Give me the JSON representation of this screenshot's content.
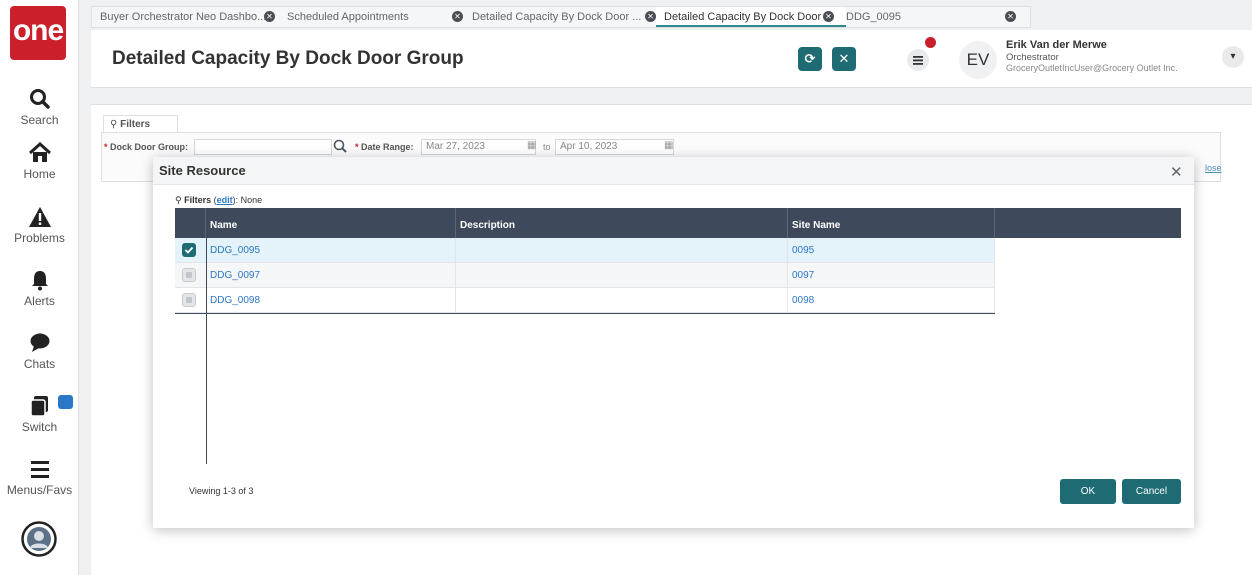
{
  "sidebar": {
    "logo_text": "one",
    "items": [
      {
        "label": "Search",
        "icon": "search-icon"
      },
      {
        "label": "Home",
        "icon": "home-icon"
      },
      {
        "label": "Problems",
        "icon": "warning-icon"
      },
      {
        "label": "Alerts",
        "icon": "bell-icon"
      },
      {
        "label": "Chats",
        "icon": "chat-icon"
      },
      {
        "label": "Switch",
        "icon": "switch-icon"
      },
      {
        "label": "Menus/Favs",
        "icon": "menu-icon"
      }
    ]
  },
  "tabs": [
    {
      "label": "Buyer Orchestrator Neo Dashbo..."
    },
    {
      "label": "Scheduled Appointments"
    },
    {
      "label": "Detailed Capacity By Dock Door ..."
    },
    {
      "label": "Detailed Capacity By Dock Door ..."
    },
    {
      "label": "DDG_0095"
    }
  ],
  "header": {
    "title": "Detailed Capacity By Dock Door Group",
    "refresh_glyph": "⟳",
    "close_glyph": "✕",
    "avatar_initials": "EV",
    "user_name": "Erik Van der Merwe",
    "user_role": "Orchestrator",
    "user_email": "GroceryOutletIncUser@Grocery Outlet Inc."
  },
  "filters": {
    "tab_label": "Filters",
    "dock_door_group_label": "Dock Door Group:",
    "date_range_label": "Date Range:",
    "date_from": "Mar 27, 2023",
    "to_label": "to",
    "date_to": "Apr 10, 2023",
    "close_link": "lose"
  },
  "modal": {
    "title": "Site Resource",
    "filters_label": "Filters",
    "edit_link": "edit",
    "filters_value": "None",
    "columns": [
      "Name",
      "Description",
      "Site Name"
    ],
    "rows": [
      {
        "name": "DDG_0095",
        "description": "",
        "site": "0095",
        "checked": true
      },
      {
        "name": "DDG_0097",
        "description": "",
        "site": "0097",
        "checked": false
      },
      {
        "name": "DDG_0098",
        "description": "",
        "site": "0098",
        "checked": false
      }
    ],
    "viewing": "Viewing 1-3 of 3",
    "ok_label": "OK",
    "cancel_label": "Cancel"
  },
  "colors": {
    "brand_red": "#cc1f2c",
    "accent_teal": "#1e6b74",
    "grid_header": "#3e4a5c",
    "link_blue": "#2b77c7"
  }
}
